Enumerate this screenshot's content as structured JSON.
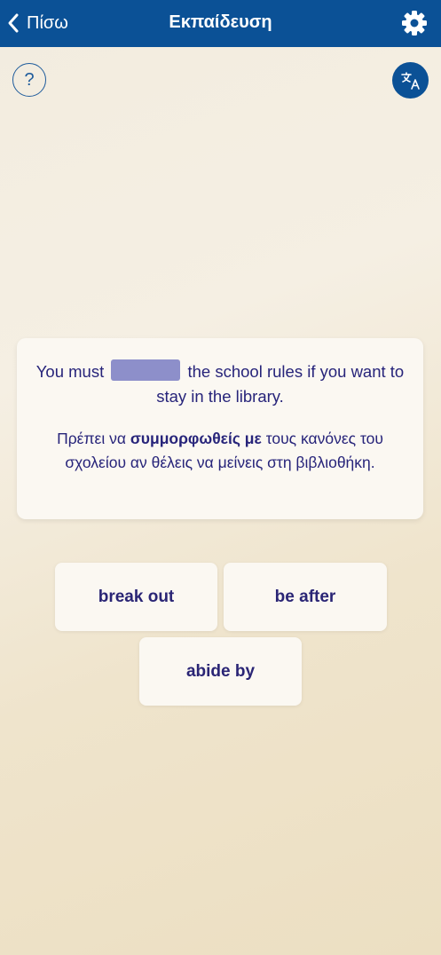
{
  "header": {
    "back_label": "Πίσω",
    "title": "Εκπαίδευση",
    "bg_color": "#0b5196"
  },
  "icons": {
    "back": "chevron-left-icon",
    "settings": "gear-icon",
    "help": "question-mark-icon",
    "translate": "translate-icon"
  },
  "help": {
    "symbol": "?"
  },
  "exercise": {
    "sentence_before": "You must",
    "sentence_after": "the school rules if you want to stay in the library.",
    "translation_before": "Πρέπει να",
    "translation_highlight": "συμμορφωθείς με",
    "translation_after": "τους κανόνες του σχολείου αν θέλεις να μείνεις στη βιβλιοθήκη.",
    "text_color": "#27247a",
    "blank_color": "#8d8fca"
  },
  "options": [
    {
      "label": "break out"
    },
    {
      "label": "be after"
    },
    {
      "label": "abide by"
    }
  ]
}
